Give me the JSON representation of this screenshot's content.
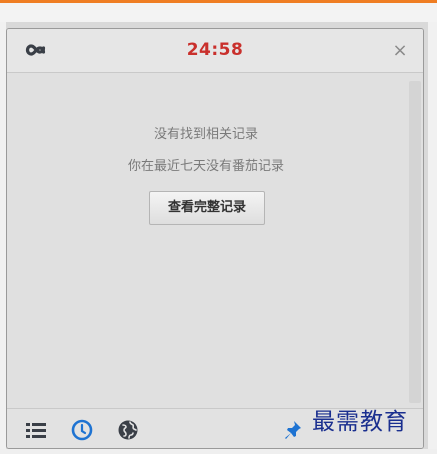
{
  "header": {
    "timer": "24:58",
    "close_symbol": "×"
  },
  "content": {
    "message_1": "没有找到相关记录",
    "message_2": "你在最近七天没有番茄记录",
    "history_button_label": "查看完整记录"
  },
  "footer": {
    "icons": [
      "list-icon",
      "clock-icon",
      "globe-icon",
      "pin-icon"
    ]
  },
  "watermark": "最需教育",
  "colors": {
    "timer": "#c9302c",
    "accent_top": "#ef7d22",
    "icon_blue": "#1e73d2",
    "icon_dark": "#3a3f47"
  }
}
